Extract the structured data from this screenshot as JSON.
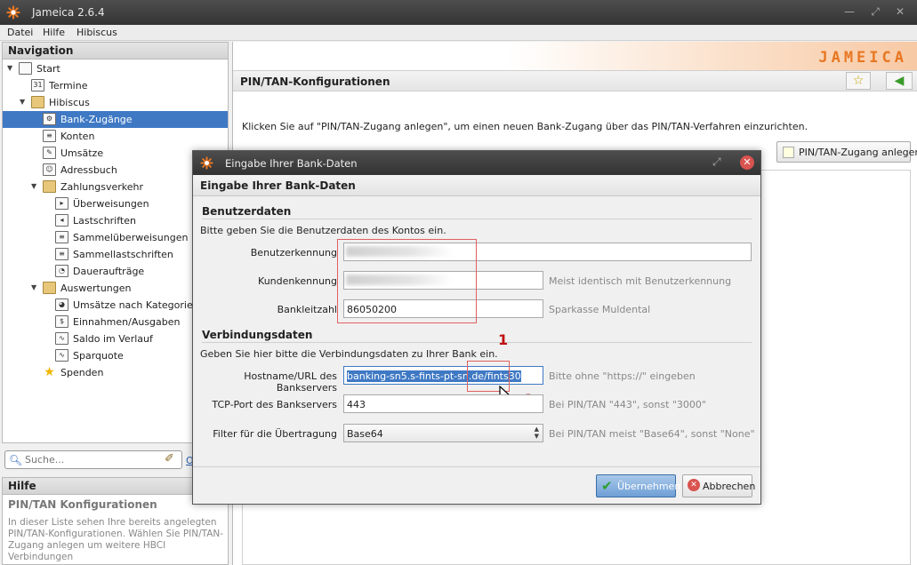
{
  "window": {
    "title": "Jameica 2.6.4"
  },
  "menu": [
    "Datei",
    "Hilfe",
    "Hibiscus"
  ],
  "navigation": {
    "header": "Navigation",
    "items": [
      {
        "label": "Start",
        "level": 0,
        "twisty": "▼",
        "icon": "monitor-icon",
        "glyph": ""
      },
      {
        "label": "Termine",
        "level": 1,
        "twisty": "",
        "icon": "calendar-icon",
        "glyph": "31"
      },
      {
        "label": "Hibiscus",
        "level": 1,
        "twisty": "▼",
        "icon": "folder-icon",
        "glyph": ""
      },
      {
        "label": "Bank-Zugänge",
        "level": 2,
        "twisty": "",
        "icon": "bank-access-icon",
        "glyph": "⚙",
        "selected": true
      },
      {
        "label": "Konten",
        "level": 2,
        "twisty": "",
        "icon": "accounts-icon",
        "glyph": "≡"
      },
      {
        "label": "Umsätze",
        "level": 2,
        "twisty": "",
        "icon": "transactions-icon",
        "glyph": "✎"
      },
      {
        "label": "Adressbuch",
        "level": 2,
        "twisty": "",
        "icon": "addressbook-icon",
        "glyph": "☺"
      },
      {
        "label": "Zahlungsverkehr",
        "level": 2,
        "twisty": "▼",
        "icon": "folder-icon",
        "glyph": ""
      },
      {
        "label": "Überweisungen",
        "level": 3,
        "twisty": "",
        "icon": "transfer-icon",
        "glyph": "▸"
      },
      {
        "label": "Lastschriften",
        "level": 3,
        "twisty": "",
        "icon": "debit-icon",
        "glyph": "◂"
      },
      {
        "label": "Sammelüberweisungen",
        "level": 3,
        "twisty": "",
        "icon": "batch-transfer-icon",
        "glyph": "≡"
      },
      {
        "label": "Sammellastschriften",
        "level": 3,
        "twisty": "",
        "icon": "batch-debit-icon",
        "glyph": "≡"
      },
      {
        "label": "Daueraufträge",
        "level": 3,
        "twisty": "",
        "icon": "clock-icon",
        "glyph": "◔"
      },
      {
        "label": "Auswertungen",
        "level": 2,
        "twisty": "▼",
        "icon": "folder-icon",
        "glyph": ""
      },
      {
        "label": "Umsätze nach Kategorien",
        "level": 3,
        "twisty": "",
        "icon": "pie-chart-icon",
        "glyph": "◕"
      },
      {
        "label": "Einnahmen/Ausgaben",
        "level": 3,
        "twisty": "",
        "icon": "income-expense-icon",
        "glyph": "$"
      },
      {
        "label": "Saldo im Verlauf",
        "level": 3,
        "twisty": "",
        "icon": "balance-chart-icon",
        "glyph": "∿"
      },
      {
        "label": "Sparquote",
        "level": 3,
        "twisty": "",
        "icon": "savings-chart-icon",
        "glyph": "∿"
      },
      {
        "label": "Spenden",
        "level": 2,
        "twisty": "",
        "icon": "star-icon",
        "glyph": "★"
      }
    ]
  },
  "search": {
    "placeholder": "Suche...",
    "link": "O"
  },
  "help": {
    "header": "Hilfe",
    "title": "PIN/TAN Konfigurationen",
    "text": "In dieser Liste sehen Ihre bereits angelegten PIN/TAN-Konfigurationen. Wählen Sie PIN/TAN-Zugang anlegen um weitere HBCI Verbindungen"
  },
  "content": {
    "logo": "JAMEICA",
    "title": "PIN/TAN-Konfigurationen",
    "info": "Klicken Sie auf \"PIN/TAN-Zugang anlegen\", um einen neuen Bank-Zugang über das PIN/TAN-Verfahren einzurichten.",
    "create_button": "PIN/TAN-Zugang anlegen"
  },
  "dialog": {
    "title": "Eingabe Ihrer Bank-Daten",
    "header": "Eingabe Ihrer Bank-Daten",
    "user_section": {
      "title": "Benutzerdaten",
      "desc": "Bitte geben Sie die Benutzerdaten des Kontos ein.",
      "user_id_label": "Benutzerkennung",
      "customer_id_label": "Kundenkennung",
      "customer_id_hint": "Meist identisch mit Benutzerkennung",
      "blz_label": "Bankleitzahl",
      "blz_value": "86050200",
      "blz_hint": "Sparkasse Muldental"
    },
    "conn_section": {
      "title": "Verbindungsdaten",
      "desc": "Geben Sie hier bitte die Verbindungsdaten zu Ihrer Bank ein.",
      "host_label": "Hostname/URL des Bankservers",
      "host_value": "banking-sn5.s-fints-pt-sn.de/fints30",
      "host_hint": "Bitte ohne \"https://\" eingeben",
      "port_label": "TCP-Port des Bankservers",
      "port_value": "443",
      "port_hint": "Bei PIN/TAN \"443\", sonst \"3000\"",
      "filter_label": "Filter für die Übertragung",
      "filter_value": "Base64",
      "filter_hint": "Bei PIN/TAN meist \"Base64\", sonst \"None\""
    },
    "annotations": [
      "1",
      "2"
    ],
    "ok_button": "Übernehmen",
    "cancel_button": "Abbrechen"
  },
  "colors": {
    "accent": "#3f79c4",
    "brand": "#e87722",
    "annotation": "#c01010"
  }
}
